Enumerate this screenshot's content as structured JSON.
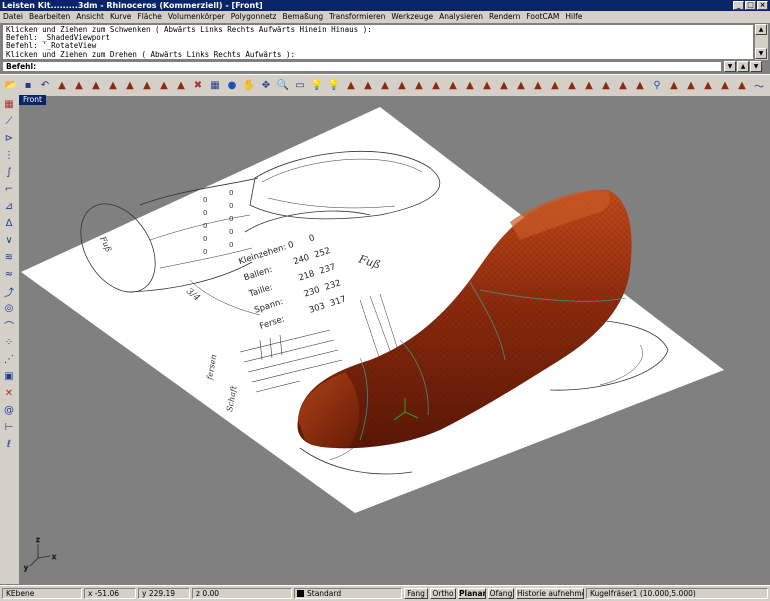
{
  "window": {
    "title": "Leisten Kit.........3dm - Rhinoceros (Kommerziell) - [Front]"
  },
  "menu": [
    "Datei",
    "Bearbeiten",
    "Ansicht",
    "Kurve",
    "Fläche",
    "Volumenkörper",
    "Polygonnetz",
    "Bemaßung",
    "Transformieren",
    "Werkzeuge",
    "Analysieren",
    "Rendern",
    "FootCAM",
    "Hilfe"
  ],
  "command_history": [
    "Klicken und Ziehen zum Schwenken ( Abwärts  Links  Rechts  Aufwärts  Hinein  Hinaus ):",
    "Befehl: _ShadedViewport",
    "Befehl: '_RotateView",
    "Klicken und Ziehen zum Drehen ( Abwärts  Links  Rechts  Aufwärts ):"
  ],
  "command_prompt": {
    "label": "Befehl:",
    "value": ""
  },
  "viewport": {
    "label": "Front"
  },
  "drawing": {
    "rows": [
      "Kleinzehen:",
      "Ballen:",
      "Taille:",
      "Spann:",
      "Ferse:"
    ],
    "col1": [
      "0",
      "240",
      "218",
      "230",
      "303"
    ],
    "col2": [
      "0",
      "252",
      "237",
      "232",
      "317"
    ],
    "note": "Fuß"
  },
  "status": {
    "layer": "KEbene",
    "x": "x -51.06",
    "y": "y 229.19",
    "z": "z 0.00",
    "layer_name": "Standard",
    "fang": "Fang",
    "ortho": "Ortho",
    "planar": "Planar",
    "ofang": "Ofang",
    "history": "Historie aufnehmen",
    "tool": "Kugelfräser1 (10.000,5.000)"
  },
  "colors": {
    "last": "#8b2a0c",
    "titlebar": "#0a246a",
    "face": "#d4d0c8",
    "viewport": "#808080"
  },
  "toolbar_icons": [
    "open-icon",
    "save-icon",
    "undo-icon",
    "last-icon",
    "last-icon",
    "last-icon",
    "last-icon",
    "last-icon",
    "last-icon",
    "last-icon",
    "last-icon",
    "delete-icon",
    "wireframe-icon",
    "sphere-icon",
    "pan-icon",
    "move-icon",
    "zoom-icon",
    "zoom-window-icon",
    "bulb-icon",
    "bulb-icon",
    "last-icon",
    "last-icon",
    "last-icon",
    "last-icon",
    "last-icon",
    "last-icon",
    "last-icon",
    "last-icon",
    "last-icon",
    "last-icon",
    "last-icon",
    "last-icon",
    "last-icon",
    "last-icon",
    "last-icon",
    "last-icon",
    "last-icon",
    "last-icon",
    "pin-icon",
    "last-icon",
    "last-icon",
    "last-icon",
    "last-icon",
    "last-icon",
    "curve-icon",
    "last-icon"
  ]
}
